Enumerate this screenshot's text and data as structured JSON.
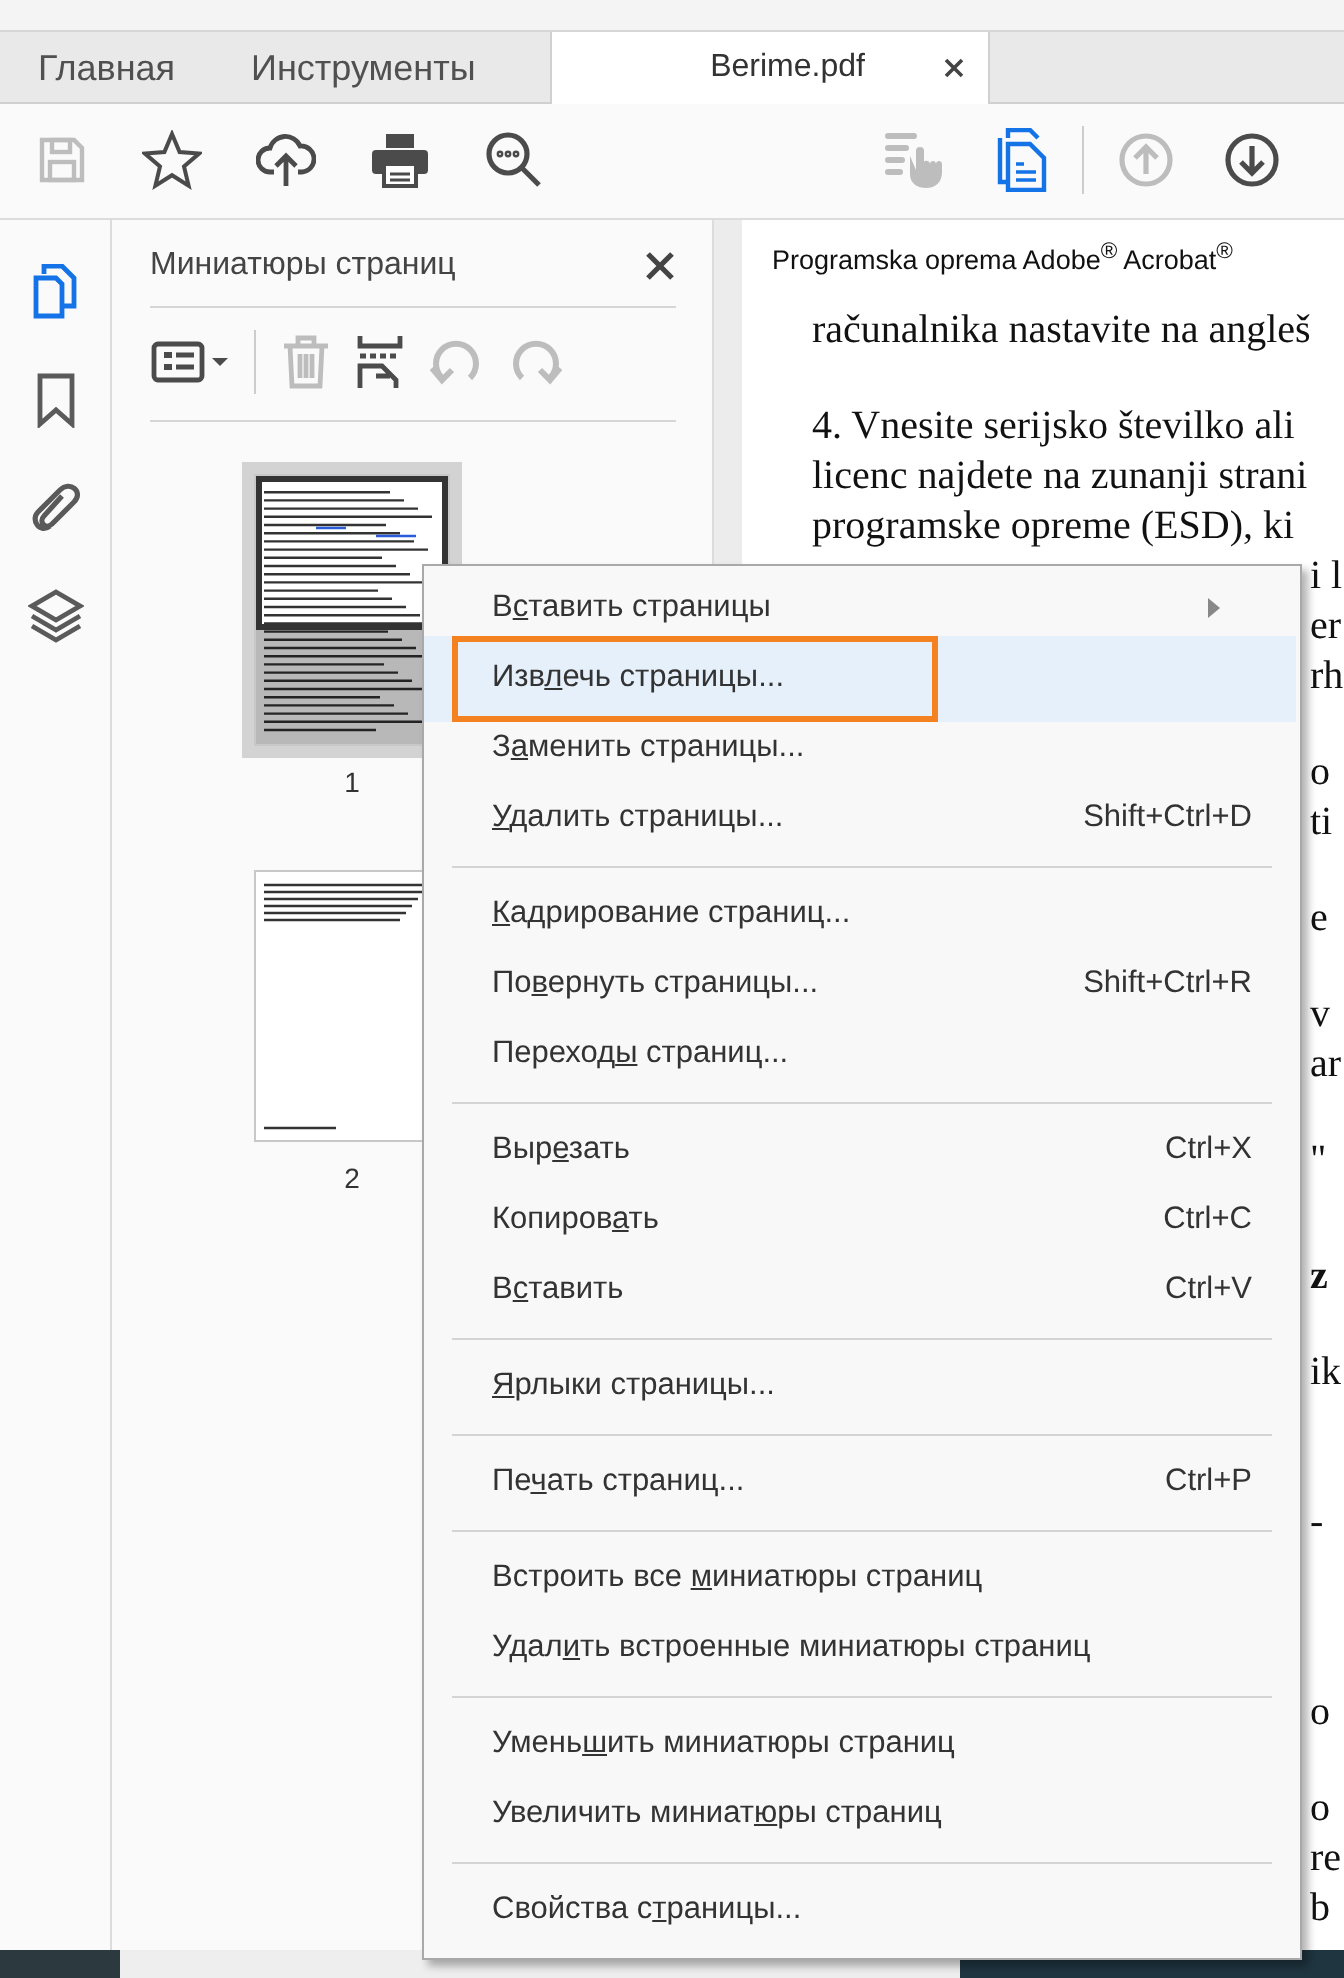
{
  "tabs": [
    {
      "label": "Главная",
      "selected": false
    },
    {
      "label": "Инструменты",
      "selected": false
    },
    {
      "label": "Berime.pdf",
      "selected": true,
      "closable": true
    }
  ],
  "toolbar": {
    "left": [
      {
        "kind": "save",
        "disabled": true
      },
      {
        "kind": "star",
        "disabled": false
      },
      {
        "kind": "upload",
        "disabled": false
      },
      {
        "kind": "print",
        "disabled": false
      },
      {
        "kind": "zoom",
        "disabled": false
      }
    ],
    "right": [
      {
        "kind": "hand",
        "disabled": true,
        "active": false
      },
      {
        "kind": "pages",
        "disabled": false,
        "active": true
      },
      {
        "kind": "up",
        "disabled": true,
        "active": false
      },
      {
        "kind": "down",
        "disabled": false,
        "active": false
      }
    ]
  },
  "side_rail": [
    {
      "kind": "pages",
      "selected": true
    },
    {
      "kind": "bookmark",
      "selected": false
    },
    {
      "kind": "attachment",
      "selected": false
    },
    {
      "kind": "layers",
      "selected": false
    }
  ],
  "thumbnails_panel": {
    "title": "Миниатюры страниц",
    "tools": [
      {
        "kind": "options",
        "disabled": false
      },
      {
        "kind": "trash",
        "disabled": true
      },
      {
        "kind": "extract",
        "disabled": false
      },
      {
        "kind": "rotate_left",
        "disabled": true
      },
      {
        "kind": "rotate_right",
        "disabled": true
      }
    ],
    "pages": [
      {
        "label": "1",
        "selected": true,
        "full": true
      },
      {
        "label": "2",
        "selected": false,
        "full": false
      }
    ]
  },
  "document": {
    "header": "Programska oprema Adobe$^{®}$ Acrobat$^{®}$",
    "lines": [
      {
        "text": "računalnika nastavite na angleš",
        "kind": "line"
      },
      {
        "text": "4. Vnesite serijsko številko ali",
        "kind": "para"
      },
      {
        "text": "licenc najdete na zunanji strani",
        "kind": "line"
      },
      {
        "text": "programske opreme (ESD), ki",
        "kind": "line"
      }
    ],
    "fragments": [
      {
        "text": "i l",
        "kind": "line"
      },
      {
        "text": "er",
        "kind": "line"
      },
      {
        "text": "rh",
        "kind": "line"
      },
      {
        "text": "o",
        "kind": "para"
      },
      {
        "text": "ti",
        "kind": "line"
      },
      {
        "text": "e",
        "kind": "para"
      },
      {
        "text": "v",
        "kind": "para"
      },
      {
        "text": "ar",
        "kind": "line"
      },
      {
        "text": "\"",
        "kind": "para"
      },
      {
        "text": "z",
        "kind": "heading"
      },
      {
        "text": "ik",
        "kind": "para"
      },
      {
        "text": "-",
        "kind": "section"
      },
      {
        "text": "o",
        "kind": "wide"
      },
      {
        "text": "o",
        "kind": "para"
      },
      {
        "text": "re",
        "kind": "line"
      },
      {
        "text": "b",
        "kind": "line"
      }
    ]
  },
  "context_menu": {
    "groups": [
      [
        {
          "pre": "В",
          "key": "с",
          "post": "тавить страницы",
          "submenu": true,
          "highlighted": false,
          "callout": false
        },
        {
          "pre": "Изв",
          "key": "л",
          "post": "ечь страницы...",
          "submenu": false,
          "highlighted": true,
          "callout": true
        },
        {
          "pre": "З",
          "key": "а",
          "post": "менить страницы...",
          "submenu": false,
          "highlighted": false,
          "callout": false
        },
        {
          "key": "У",
          "post": "далить страницы...",
          "shortcut": "Shift+Ctrl+D",
          "submenu": false,
          "highlighted": false,
          "callout": false
        }
      ],
      [
        {
          "key": "К",
          "post": "адрирование страниц...",
          "submenu": false,
          "highlighted": false,
          "callout": false
        },
        {
          "pre": "По",
          "key": "в",
          "post": "ернуть страницы...",
          "shortcut": "Shift+Ctrl+R",
          "submenu": false,
          "highlighted": false,
          "callout": false
        },
        {
          "pre": "Переход",
          "key": "ы",
          "post": " страниц...",
          "submenu": false,
          "highlighted": false,
          "callout": false
        }
      ],
      [
        {
          "pre": "Выр",
          "key": "е",
          "post": "зать",
          "shortcut": "Ctrl+X",
          "submenu": false,
          "highlighted": false,
          "callout": false
        },
        {
          "pre": "Копиров",
          "key": "а",
          "post": "ть",
          "shortcut": "Ctrl+C",
          "submenu": false,
          "highlighted": false,
          "callout": false
        },
        {
          "pre": "В",
          "key": "с",
          "post": "тавить",
          "shortcut": "Ctrl+V",
          "submenu": false,
          "highlighted": false,
          "callout": false
        }
      ],
      [
        {
          "key": "Я",
          "post": "рлыки страницы...",
          "submenu": false,
          "highlighted": false,
          "callout": false
        }
      ],
      [
        {
          "pre": "Пе",
          "key": "ч",
          "post": "ать страниц...",
          "shortcut": "Ctrl+P",
          "submenu": false,
          "highlighted": false,
          "callout": false
        }
      ],
      [
        {
          "pre": "Встроить все ",
          "key": "м",
          "post": "иниатюры страниц",
          "submenu": false,
          "highlighted": false,
          "callout": false
        },
        {
          "pre": "Удал",
          "key": "и",
          "post": "ть встроенные миниатюры страниц",
          "submenu": false,
          "highlighted": false,
          "callout": false
        }
      ],
      [
        {
          "pre": "Умень",
          "key": "ш",
          "post": "ить миниатюры страниц",
          "submenu": false,
          "highlighted": false,
          "callout": false
        },
        {
          "pre": "Увеличить миниат",
          "key": "ю",
          "post": "ры страниц",
          "submenu": false,
          "highlighted": false,
          "callout": false
        }
      ],
      [
        {
          "pre": "Свойства с",
          "key": "т",
          "post": "раницы...",
          "submenu": false,
          "highlighted": false,
          "callout": false
        }
      ]
    ]
  }
}
